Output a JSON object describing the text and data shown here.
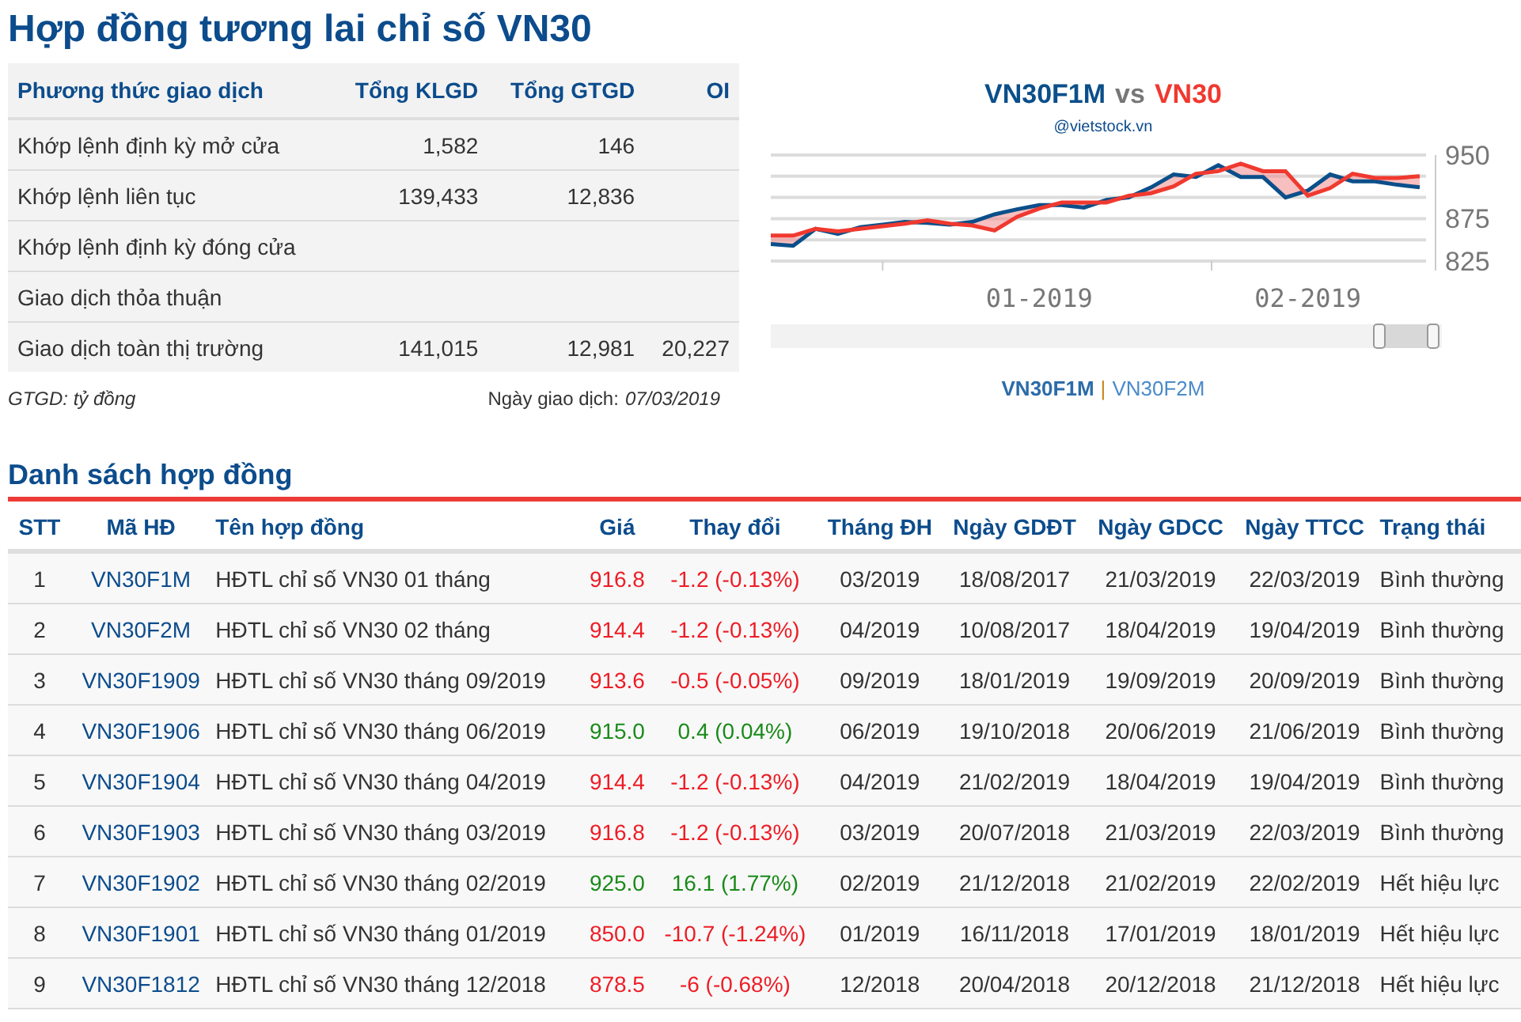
{
  "page_title": "Hợp đồng tương lai chỉ số VN30",
  "summary": {
    "columns": [
      "Phương thức giao dịch",
      "Tổng KLGD",
      "Tổng GTGD",
      "OI"
    ],
    "rows": [
      [
        "Khớp lệnh định kỳ mở cửa",
        "1,582",
        "146",
        ""
      ],
      [
        "Khớp lệnh liên tục",
        "139,433",
        "12,836",
        ""
      ],
      [
        "Khớp lệnh định kỳ đóng cửa",
        "",
        "",
        ""
      ],
      [
        "Giao dịch thỏa thuận",
        "",
        "",
        ""
      ],
      [
        "Giao dịch toàn thị trường",
        "141,015",
        "12,981",
        "20,227"
      ]
    ],
    "note": "GTGD: tỷ đồng",
    "date_label": "Ngày giao dịch:",
    "date": "07/03/2019"
  },
  "chart": {
    "title_joiner": "vs",
    "credit": "@vietstock.vn",
    "chart_data": {
      "type": "line",
      "categories": [
        null,
        null,
        null,
        null,
        null,
        null,
        null,
        null,
        null,
        null,
        null,
        null,
        "01-2019",
        null,
        null,
        null,
        null,
        null,
        null,
        null,
        null,
        null,
        null,
        null,
        "02-2019",
        null,
        null,
        null,
        null,
        null
      ],
      "series": [
        {
          "name": "VN30F1M",
          "color": "#0b4f8a",
          "values": [
            845,
            843,
            863,
            857,
            865,
            868,
            871,
            870,
            868,
            871,
            880,
            886,
            891,
            891,
            888,
            897,
            900,
            912,
            927,
            924,
            938,
            924,
            924,
            900,
            908,
            927,
            919,
            919,
            915,
            912
          ]
        },
        {
          "name": "VN30",
          "color": "#f0392f",
          "values": [
            855,
            855,
            863,
            860,
            863,
            866,
            869,
            873,
            869,
            867,
            861,
            877,
            887,
            894,
            894,
            894,
            902,
            905,
            913,
            928,
            931,
            940,
            931,
            931,
            902,
            911,
            928,
            923,
            923,
            925
          ]
        }
      ],
      "ylim": [
        825,
        950
      ],
      "yticks": [
        825,
        875,
        950
      ]
    },
    "legend": [
      {
        "label": "VN30F1M",
        "selected": true
      },
      {
        "label": "VN30F2M",
        "selected": false
      }
    ],
    "legend_separator": "|"
  },
  "contracts": {
    "heading": "Danh sách hợp đồng",
    "columns": [
      "STT",
      "Mã HĐ",
      "Tên hợp đồng",
      "Giá",
      "Thay đổi",
      "Tháng ĐH",
      "Ngày GDĐT",
      "Ngày GDCC",
      "Ngày TTCC",
      "Trạng thái"
    ],
    "rows": [
      {
        "color": "#ee1c25",
        "cells": [
          "1",
          "VN30F1M",
          "HĐTL chỉ số VN30 01 tháng",
          "916.8",
          "-1.2 (-0.13%)",
          "03/2019",
          "18/08/2017",
          "21/03/2019",
          "22/03/2019",
          "Bình thường"
        ]
      },
      {
        "color": "#ee1c25",
        "cells": [
          "2",
          "VN30F2M",
          "HĐTL chỉ số VN30 02 tháng",
          "914.4",
          "-1.2 (-0.13%)",
          "04/2019",
          "10/08/2017",
          "18/04/2019",
          "19/04/2019",
          "Bình thường"
        ]
      },
      {
        "color": "#ee1c25",
        "cells": [
          "3",
          "VN30F1909",
          "HĐTL chỉ số VN30 tháng 09/2019",
          "913.6",
          "-0.5 (-0.05%)",
          "09/2019",
          "18/01/2019",
          "19/09/2019",
          "20/09/2019",
          "Bình thường"
        ]
      },
      {
        "color": "#1a8a1a",
        "cells": [
          "4",
          "VN30F1906",
          "HĐTL chỉ số VN30 tháng 06/2019",
          "915.0",
          "0.4 (0.04%)",
          "06/2019",
          "19/10/2018",
          "20/06/2019",
          "21/06/2019",
          "Bình thường"
        ]
      },
      {
        "color": "#ee1c25",
        "cells": [
          "5",
          "VN30F1904",
          "HĐTL chỉ số VN30 tháng 04/2019",
          "914.4",
          "-1.2 (-0.13%)",
          "04/2019",
          "21/02/2019",
          "18/04/2019",
          "19/04/2019",
          "Bình thường"
        ]
      },
      {
        "color": "#ee1c25",
        "cells": [
          "6",
          "VN30F1903",
          "HĐTL chỉ số VN30 tháng 03/2019",
          "916.8",
          "-1.2 (-0.13%)",
          "03/2019",
          "20/07/2018",
          "21/03/2019",
          "22/03/2019",
          "Bình thường"
        ]
      },
      {
        "color": "#1a8a1a",
        "cells": [
          "7",
          "VN30F1902",
          "HĐTL chỉ số VN30 tháng 02/2019",
          "925.0",
          "16.1 (1.77%)",
          "02/2019",
          "21/12/2018",
          "21/02/2019",
          "22/02/2019",
          "Hết hiệu lực"
        ]
      },
      {
        "color": "#ee1c25",
        "cells": [
          "8",
          "VN30F1901",
          "HĐTL chỉ số VN30 tháng 01/2019",
          "850.0",
          "-10.7 (-1.24%)",
          "01/2019",
          "16/11/2018",
          "17/01/2019",
          "18/01/2019",
          "Hết hiệu lực"
        ]
      },
      {
        "color": "#ee1c25",
        "cells": [
          "9",
          "VN30F1812",
          "HĐTL chỉ số VN30 tháng 12/2018",
          "878.5",
          "-6 (-0.68%)",
          "12/2018",
          "20/04/2018",
          "20/12/2018",
          "21/12/2018",
          "Hết hiệu lực"
        ]
      }
    ]
  }
}
